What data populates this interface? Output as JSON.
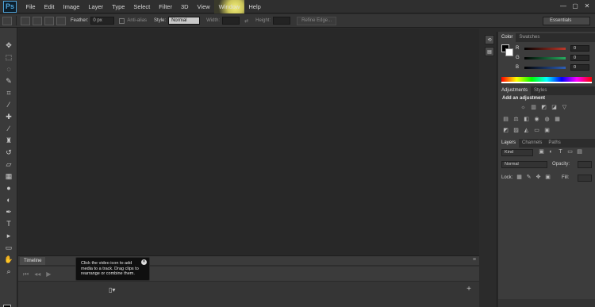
{
  "app": {
    "logo": "Ps"
  },
  "menu": [
    "File",
    "Edit",
    "Image",
    "Layer",
    "Type",
    "Select",
    "Filter",
    "3D",
    "View",
    "Window",
    "Help"
  ],
  "window_controls": {
    "minimize": "—",
    "restore": "▢",
    "close": "✕"
  },
  "options_bar": {
    "feather_label": "Feather:",
    "feather_value": "0 px",
    "antialias_label": "Anti-alias",
    "style_label": "Style:",
    "style_value": "Normal",
    "width_label": "Width:",
    "height_label": "Height:",
    "refine_edge": "Refine Edge...",
    "workspace": "Essentials"
  },
  "timeline": {
    "tab": "Timeline",
    "tooltip": "Click the video icon to add media to a track. Drag clips to rearrange or combine them."
  },
  "color_panel": {
    "tabs": [
      "Color",
      "Swatches"
    ],
    "r_label": "R",
    "g_label": "G",
    "b_label": "B",
    "r_value": "0",
    "g_value": "0",
    "b_value": "0",
    "colors": {
      "r": "#c0392b",
      "g": "#27ae60",
      "b": "#2e5fb7"
    }
  },
  "adjustments_panel": {
    "tabs": [
      "Adjustments",
      "Styles"
    ],
    "title": "Add an adjustment"
  },
  "layers_panel": {
    "tabs": [
      "Layers",
      "Channels",
      "Paths"
    ],
    "kind": "Kind",
    "blend_mode": "Normal",
    "opacity_label": "Opacity:",
    "lock_label": "Lock:",
    "fill_label": "Fill:"
  }
}
